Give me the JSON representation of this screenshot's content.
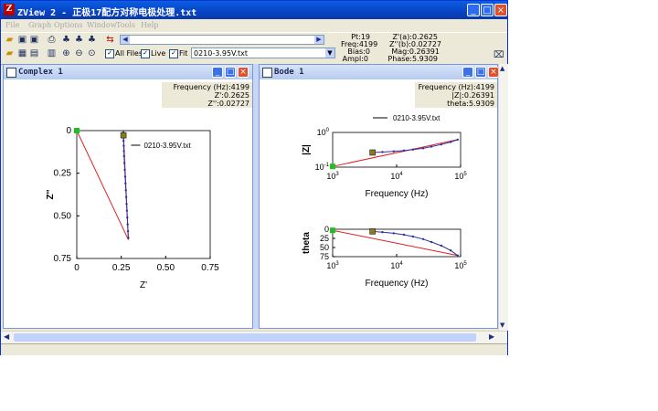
{
  "window": {
    "title": "ZView 2 - 正极17配方对称电极处理.txt",
    "minimize_label": "_",
    "maximize_label": "□",
    "close_label": "×"
  },
  "menu": [
    "File",
    "Graph",
    "Options",
    "Window",
    "Tools",
    "Help"
  ],
  "toolbar": {
    "file_select_value": "0210-3.95V.txt",
    "all_files_label": "All Files",
    "live_label": "Live",
    "fit_label": "Fit",
    "all_files_checked": true,
    "live_checked": true,
    "fit_checked": true
  },
  "readouts": {
    "pt": "Pt:19",
    "freq": "Freq:4199",
    "bias": "Bias:0",
    "ampl": "Ampl:0",
    "zre": "Z'(a):0.2625",
    "zim": "Z''(b):0.02727",
    "mag": "Mag:0.26391",
    "phase": "Phase:5.9309"
  },
  "complex_pane": {
    "title": "Complex 1",
    "info": [
      "Frequency (Hz):4199",
      "Z':0.2625",
      "Z'':0.02727"
    ]
  },
  "bode_pane": {
    "title": "Bode 1",
    "info": [
      "Frequency (Hz):4199",
      "|Z|:0.26391",
      "theta:5.9309"
    ]
  },
  "chart_data": [
    {
      "type": "scatter",
      "xlabel": "Z'",
      "ylabel": "Z''",
      "xlim": [
        0,
        0.75
      ],
      "ylim": [
        0,
        0.75
      ],
      "y_inverted": true,
      "x_ticks": [
        "0",
        "0.25",
        "0.50",
        "0.75"
      ],
      "y_ticks": [
        "0",
        "0.25",
        "0.50",
        "0.75"
      ],
      "legend": "0210-3.95V.txt",
      "series": [
        {
          "name": "0210-3.95V.txt",
          "x": [
            0.262,
            0.262,
            0.263,
            0.264,
            0.265,
            0.266,
            0.268,
            0.27,
            0.272,
            0.274,
            0.276,
            0.278,
            0.28,
            0.282,
            0.284,
            0.286,
            0.288,
            0.29
          ],
          "y": [
            0.01,
            0.03,
            0.06,
            0.09,
            0.12,
            0.15,
            0.19,
            0.23,
            0.27,
            0.31,
            0.35,
            0.39,
            0.43,
            0.47,
            0.51,
            0.55,
            0.59,
            0.63
          ]
        }
      ],
      "fit_line": {
        "x": [
          0,
          0.29
        ],
        "y": [
          0,
          0.64
        ]
      },
      "marker_point": {
        "x": 0.0,
        "y": 0.0
      },
      "selected_point": {
        "x": 0.2625,
        "y": 0.02727
      }
    },
    {
      "type": "line",
      "xlabel": "Frequency (Hz)",
      "ylabel": "|Z|",
      "x_scale": "log",
      "y_scale": "log",
      "x_ticks": [
        "10^3",
        "10^4",
        "10^5"
      ],
      "y_ticks": [
        "10^0",
        "10^-1"
      ],
      "xlim": [
        1000,
        100000
      ],
      "ylim": [
        0.1,
        1
      ],
      "legend": "0210-3.95V.txt",
      "series": [
        {
          "name": "0210-3.95V.txt",
          "x": [
            4199,
            6000,
            9000,
            13000,
            18000,
            26000,
            35000,
            50000,
            70000,
            90000
          ],
          "y": [
            0.264,
            0.272,
            0.285,
            0.3,
            0.32,
            0.35,
            0.39,
            0.45,
            0.53,
            0.62
          ]
        }
      ],
      "fit_line": {
        "x": [
          1000,
          90000
        ],
        "y": [
          0.105,
          0.62
        ]
      },
      "selected_point": {
        "x": 4199,
        "y": 0.26391
      }
    },
    {
      "type": "line",
      "xlabel": "Frequency (Hz)",
      "ylabel": "theta",
      "x_scale": "log",
      "x_ticks": [
        "10^3",
        "10^4",
        "10^5"
      ],
      "y_ticks": [
        "0",
        "25",
        "50",
        "75"
      ],
      "xlim": [
        1000,
        100000
      ],
      "ylim": [
        0,
        75
      ],
      "y_inverted": true,
      "series": [
        {
          "name": "0210-3.95V.txt",
          "x": [
            4199,
            6000,
            9000,
            13000,
            18000,
            26000,
            35000,
            50000,
            70000,
            90000
          ],
          "y": [
            5.93,
            8,
            11,
            15,
            20,
            27,
            35,
            45,
            58,
            72
          ]
        }
      ],
      "fit_line": {
        "x": [
          1000,
          90000
        ],
        "y": [
          3,
          72
        ]
      },
      "selected_point": {
        "x": 4199,
        "y": 5.9309
      }
    }
  ],
  "colors": {
    "data": "#3030a0",
    "fit": "#e02020",
    "marker": "#20c020",
    "selected": "#8a7a20"
  }
}
